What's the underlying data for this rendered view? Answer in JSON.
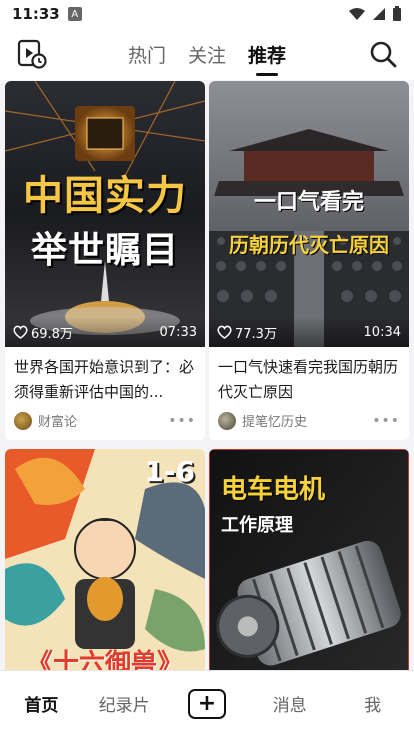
{
  "status_bar": {
    "time": "11:33",
    "badge": "A"
  },
  "top_nav": {
    "tabs": [
      {
        "label": "热门",
        "active": false
      },
      {
        "label": "关注",
        "active": false
      },
      {
        "label": "推荐",
        "active": true
      }
    ],
    "left_icon": "video-history-icon",
    "right_icon": "search-icon"
  },
  "feed": [
    {
      "overlay_line1": "中国实力",
      "overlay_line2": "举世瞩目",
      "likes": "69.8万",
      "duration": "07:33",
      "title": "世界各国开始意识到了：必须得重新评估中国的...",
      "author": "财富论"
    },
    {
      "overlay_line1": "一口气看完",
      "overlay_line2": "历朝历代灭亡原因",
      "likes": "77.3万",
      "duration": "10:34",
      "title": "一口气快速看完我国历朝历代灭亡原因",
      "author": "提笔忆历史"
    },
    {
      "overlay_line1": "1-6",
      "overlay_line2": "《十六御兽》"
    },
    {
      "overlay_line1": "电车电机",
      "overlay_line2": "工作原理"
    }
  ],
  "bottom_nav": {
    "items": [
      {
        "label": "首页",
        "active": true
      },
      {
        "label": "纪录片",
        "active": false
      },
      {
        "label": "",
        "icon": "add-icon"
      },
      {
        "label": "消息",
        "active": false
      },
      {
        "label": "我",
        "active": false
      }
    ],
    "add_symbol": "+"
  }
}
